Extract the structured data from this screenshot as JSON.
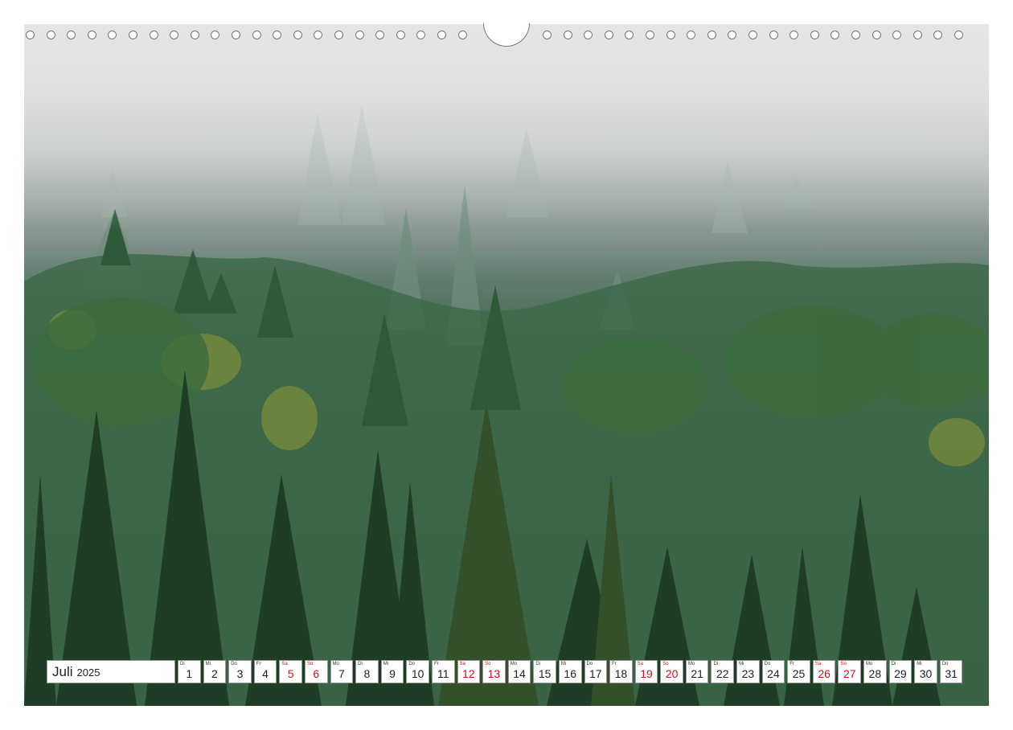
{
  "calendar": {
    "month": "Juli",
    "year": "2025",
    "days": [
      {
        "wd": "Di",
        "n": "1",
        "weekend": false
      },
      {
        "wd": "Mi",
        "n": "2",
        "weekend": false
      },
      {
        "wd": "Do",
        "n": "3",
        "weekend": false
      },
      {
        "wd": "Fr",
        "n": "4",
        "weekend": false
      },
      {
        "wd": "Sa",
        "n": "5",
        "weekend": true
      },
      {
        "wd": "So",
        "n": "6",
        "weekend": true
      },
      {
        "wd": "Mo",
        "n": "7",
        "weekend": false
      },
      {
        "wd": "Di",
        "n": "8",
        "weekend": false
      },
      {
        "wd": "Mi",
        "n": "9",
        "weekend": false
      },
      {
        "wd": "Do",
        "n": "10",
        "weekend": false
      },
      {
        "wd": "Fr",
        "n": "11",
        "weekend": false
      },
      {
        "wd": "Sa",
        "n": "12",
        "weekend": true
      },
      {
        "wd": "So",
        "n": "13",
        "weekend": true
      },
      {
        "wd": "Mo",
        "n": "14",
        "weekend": false
      },
      {
        "wd": "Di",
        "n": "15",
        "weekend": false
      },
      {
        "wd": "Mi",
        "n": "16",
        "weekend": false
      },
      {
        "wd": "Do",
        "n": "17",
        "weekend": false
      },
      {
        "wd": "Fr",
        "n": "18",
        "weekend": false
      },
      {
        "wd": "Sa",
        "n": "19",
        "weekend": true
      },
      {
        "wd": "So",
        "n": "20",
        "weekend": true
      },
      {
        "wd": "Mo",
        "n": "21",
        "weekend": false
      },
      {
        "wd": "Di",
        "n": "22",
        "weekend": false
      },
      {
        "wd": "Mi",
        "n": "23",
        "weekend": false
      },
      {
        "wd": "Do",
        "n": "24",
        "weekend": false
      },
      {
        "wd": "Fr",
        "n": "25",
        "weekend": false
      },
      {
        "wd": "Sa",
        "n": "26",
        "weekend": true
      },
      {
        "wd": "So",
        "n": "27",
        "weekend": true
      },
      {
        "wd": "Mo",
        "n": "28",
        "weekend": false
      },
      {
        "wd": "Di",
        "n": "29",
        "weekend": false
      },
      {
        "wd": "Mi",
        "n": "30",
        "weekend": false
      },
      {
        "wd": "Do",
        "n": "31",
        "weekend": false
      }
    ]
  },
  "colors": {
    "weekend": "#c4161c",
    "fog": "#d8dbd8",
    "forest_dark": "#203d27",
    "forest_mid": "#3f6a45"
  }
}
